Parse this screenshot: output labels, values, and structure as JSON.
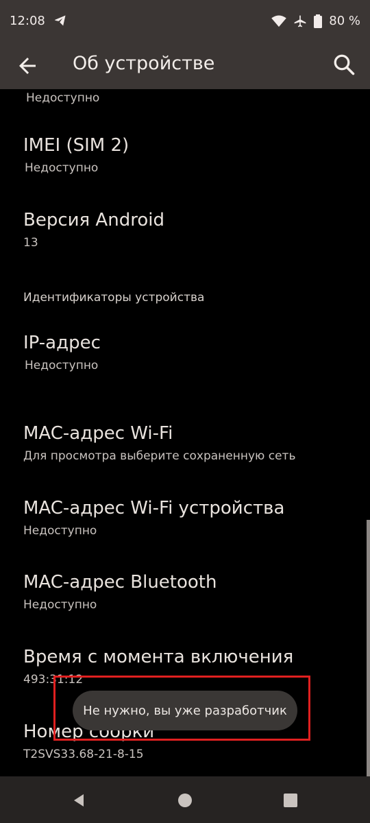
{
  "status_bar": {
    "time": "12:08",
    "battery": "80 %"
  },
  "app_bar": {
    "title": "Об устройстве"
  },
  "items": {
    "top_partial_sub": "Недоступно",
    "imei2": {
      "title": "IMEI (SIM 2)",
      "sub": "Недоступно"
    },
    "android_version": {
      "title": "Версия Android",
      "sub": "13"
    },
    "section_ids": "Идентификаторы устройства",
    "ip": {
      "title": "IP-адрес",
      "sub": "Недоступно"
    },
    "wifi_mac": {
      "title": "MAC-адрес Wi-Fi",
      "sub": "Для просмотра выберите сохраненную сеть"
    },
    "device_wifi_mac": {
      "title": "MAC-адрес Wi-Fi устройства",
      "sub": "Недоступно"
    },
    "bt_mac": {
      "title": "MAC-адрес Bluetooth",
      "sub": "Недоступно"
    },
    "uptime": {
      "title": "Время с момента включения",
      "sub": "493:31:12"
    },
    "build": {
      "title": "Номер сборки",
      "sub": "T2SVS33.68-21-8-15"
    }
  },
  "toast": {
    "text": "Не нужно, вы уже разработчик"
  },
  "colors": {
    "app_bar_bg": "#3b3634",
    "background": "#000000",
    "highlight": "#e02020"
  }
}
